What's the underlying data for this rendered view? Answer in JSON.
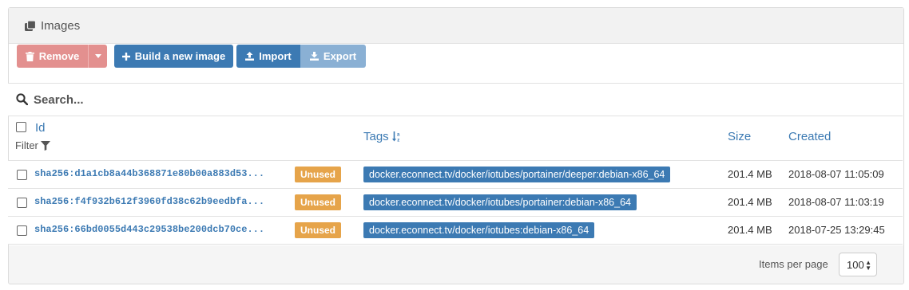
{
  "panel": {
    "title": "Images",
    "title_icon": "clone-icon"
  },
  "toolbar": {
    "remove_label": "Remove",
    "build_label": "Build a new image",
    "import_label": "Import",
    "export_label": "Export"
  },
  "search": {
    "placeholder": "Search..."
  },
  "table": {
    "headers": {
      "id": "Id",
      "filter": "Filter",
      "tags": "Tags",
      "size": "Size",
      "created": "Created"
    },
    "rows": [
      {
        "id": "sha256:d1a1cb8a44b368871e80b00a883d53...",
        "status": "Unused",
        "tag": "docker.econnect.tv/docker/iotubes/portainer/deeper:debian-x86_64",
        "size": "201.4 MB",
        "created": "2018-08-07 11:05:09"
      },
      {
        "id": "sha256:f4f932b612f3960fd38c62b9eedbfa...",
        "status": "Unused",
        "tag": "docker.econnect.tv/docker/iotubes/portainer:debian-x86_64",
        "size": "201.4 MB",
        "created": "2018-08-07 11:03:19"
      },
      {
        "id": "sha256:66bd0055d443c29538be200dcb70ce...",
        "status": "Unused",
        "tag": "docker.econnect.tv/docker/iotubes:debian-x86_64",
        "size": "201.4 MB",
        "created": "2018-07-25 13:29:45"
      }
    ]
  },
  "pagination": {
    "items_per_page_label": "Items per page",
    "items_per_page": "100"
  },
  "colors": {
    "primary": "#3c7ab3",
    "danger": "#e3908f",
    "warning": "#e6a44a"
  }
}
